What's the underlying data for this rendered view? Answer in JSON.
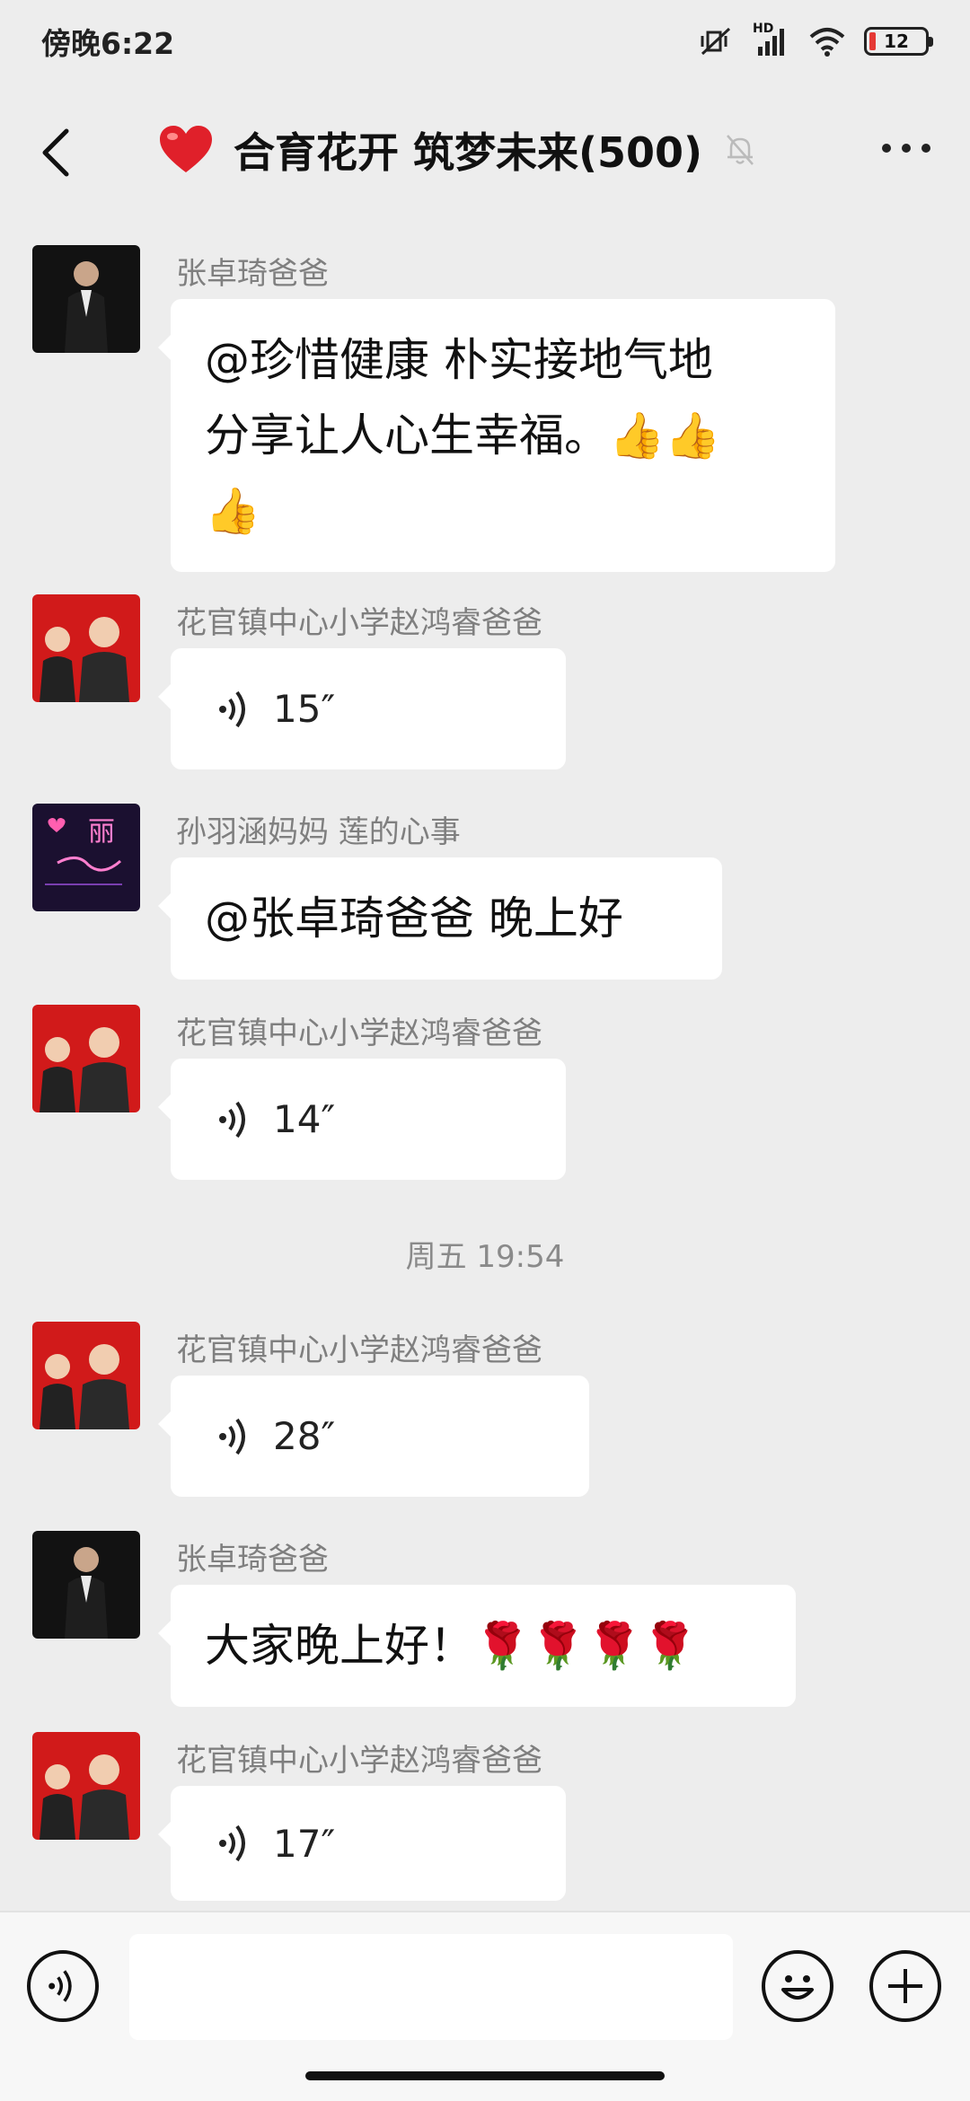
{
  "status_bar": {
    "time": "傍晚6:22",
    "network": "HD",
    "battery": "12"
  },
  "header": {
    "title": "合育花开 筑梦未来(500)",
    "title_emoji": "❤️"
  },
  "messages": [
    {
      "sender": "张卓琦爸爸",
      "type": "text",
      "line1": "@珍惜健康  朴实接地气地",
      "line2": "分享让人心生幸福。👍👍",
      "line3": "👍"
    },
    {
      "sender": "花官镇中心小学赵鸿睿爸爸",
      "type": "voice",
      "duration": "15″"
    },
    {
      "sender": "孙羽涵妈妈  莲的心事",
      "type": "text",
      "line1": "@张卓琦爸爸  晚上好"
    },
    {
      "sender": "花官镇中心小学赵鸿睿爸爸",
      "type": "voice",
      "duration": "14″"
    },
    {
      "sender": "花官镇中心小学赵鸿睿爸爸",
      "type": "voice",
      "duration": "28″"
    },
    {
      "sender": "张卓琦爸爸",
      "type": "text",
      "line1": "大家晚上好！🌹🌹🌹🌹"
    },
    {
      "sender": "花官镇中心小学赵鸿睿爸爸",
      "type": "voice",
      "duration": "17″"
    }
  ],
  "timestamp": "周五 19:54",
  "avatar3_text": "丽",
  "input": {
    "value": "",
    "placeholder": ""
  },
  "colors": {
    "background": "#ededed",
    "bubble": "#ffffff",
    "sender_name": "#7f7f7f"
  },
  "icons": [
    "back-arrow-icon",
    "heart-icon",
    "mute-bell-icon",
    "more-icon",
    "voice-wave-icon",
    "emoji-icon",
    "plus-icon"
  ]
}
